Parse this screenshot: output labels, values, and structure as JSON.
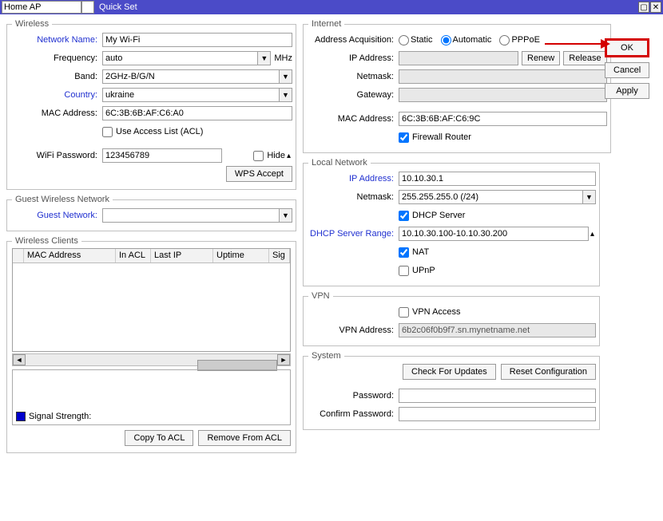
{
  "title": {
    "mode": "Home AP",
    "text": "Quick Set"
  },
  "buttons": {
    "ok": "OK",
    "cancel": "Cancel",
    "apply": "Apply"
  },
  "wireless": {
    "legend": "Wireless",
    "network_name_lbl": "Network Name:",
    "network_name": "My Wi-Fi",
    "frequency_lbl": "Frequency:",
    "frequency": "auto",
    "frequency_unit": "MHz",
    "band_lbl": "Band:",
    "band": "2GHz-B/G/N",
    "country_lbl": "Country:",
    "country": "ukraine",
    "mac_lbl": "MAC Address:",
    "mac": "6C:3B:6B:AF:C6:A0",
    "use_acl_lbl": "Use Access List (ACL)",
    "wifi_pw_lbl": "WiFi Password:",
    "wifi_pw": "123456789",
    "hide_lbl": "Hide",
    "wps_btn": "WPS Accept"
  },
  "guest": {
    "legend": "Guest Wireless Network",
    "lbl": "Guest Network:",
    "value": ""
  },
  "clients": {
    "legend": "Wireless Clients",
    "cols": {
      "mac": "MAC Address",
      "inacl": "In ACL",
      "lastip": "Last IP",
      "uptime": "Uptime",
      "sig": "Sig"
    },
    "signal_lbl": "Signal Strength:",
    "copy_btn": "Copy To ACL",
    "remove_btn": "Remove From ACL"
  },
  "internet": {
    "legend": "Internet",
    "acq_lbl": "Address Acquisition:",
    "static": "Static",
    "auto": "Automatic",
    "pppoe": "PPPoE",
    "ip_lbl": "IP Address:",
    "renew": "Renew",
    "release": "Release",
    "netmask_lbl": "Netmask:",
    "gateway_lbl": "Gateway:",
    "mac_lbl": "MAC Address:",
    "mac": "6C:3B:6B:AF:C6:9C",
    "firewall_lbl": "Firewall Router"
  },
  "local": {
    "legend": "Local Network",
    "ip_lbl": "IP Address:",
    "ip": "10.10.30.1",
    "netmask_lbl": "Netmask:",
    "netmask": "255.255.255.0 (/24)",
    "dhcp_srv_lbl": "DHCP Server",
    "dhcp_range_lbl": "DHCP Server Range:",
    "dhcp_range": "10.10.30.100-10.10.30.200",
    "nat_lbl": "NAT",
    "upnp_lbl": "UPnP"
  },
  "vpn": {
    "legend": "VPN",
    "access_lbl": "VPN Access",
    "addr_lbl": "VPN Address:",
    "addr": "6b2c06f0b9f7.sn.mynetname.net"
  },
  "system": {
    "legend": "System",
    "check_btn": "Check For Updates",
    "reset_btn": "Reset Configuration",
    "pw_lbl": "Password:",
    "cpw_lbl": "Confirm Password:"
  }
}
